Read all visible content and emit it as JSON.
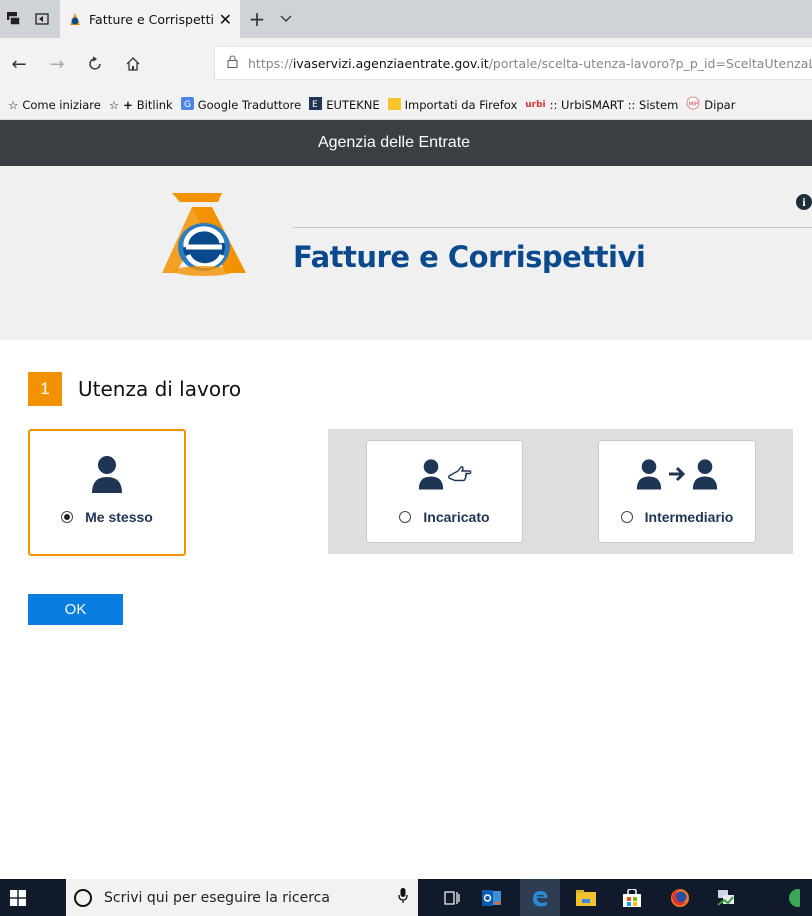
{
  "browser": {
    "tab_title": "Fatture e Corrispettivi -",
    "tab_close": "✕",
    "new_tab": "+",
    "url_domain": "ivaservizi.agenziaentrate.gov.it",
    "url_prefix": "https://",
    "url_path": "/portale/scelta-utenza-lavoro?p_p_id=SceltaUtenzaLav",
    "favorites": [
      "Come iniziare",
      "Bitlink",
      "Google Traduttore",
      "EUTEKNE",
      "Importati da Firefox",
      ":: UrbiSMART :: Sistem",
      "Dipar"
    ]
  },
  "header": {
    "title": "Agenzia delle Entrate"
  },
  "banner": {
    "title": "Fatture e Corrispettivi"
  },
  "step": {
    "number": "1",
    "title": "Utenza di lavoro"
  },
  "options": [
    {
      "label": "Me stesso",
      "selected": true
    },
    {
      "label": "Incaricato",
      "selected": false
    },
    {
      "label": "Intermediario",
      "selected": false
    }
  ],
  "ok_button": "OK",
  "taskbar": {
    "search_placeholder": "Scrivi qui per eseguire la ricerca"
  },
  "colors": {
    "accent": "#f39200",
    "brand": "#0a4a8c",
    "button": "#0a7ee0",
    "header": "#3a3f44"
  }
}
